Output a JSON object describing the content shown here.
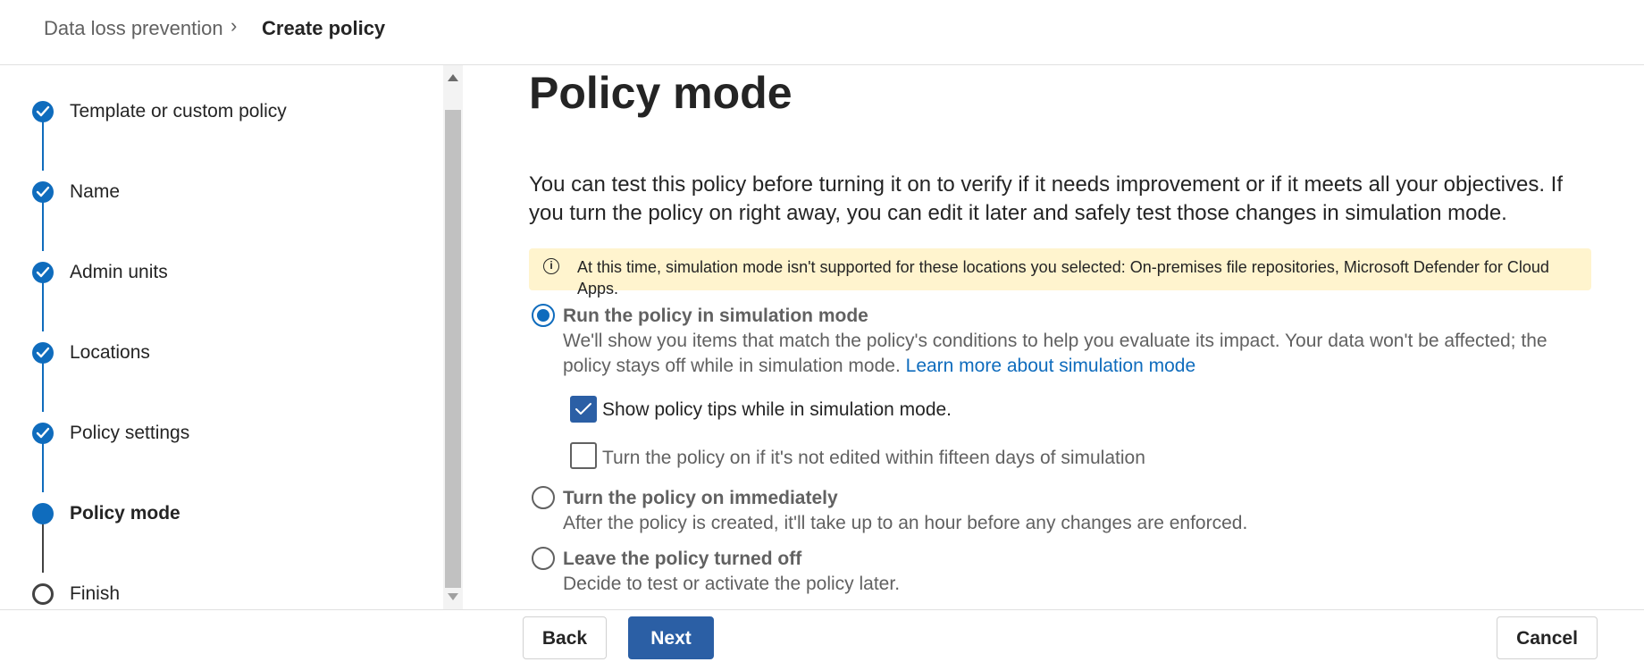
{
  "breadcrumb": {
    "root": "Data loss prevention",
    "separator": "›",
    "current": "Create policy"
  },
  "steps": [
    {
      "label": "Template or custom policy",
      "status": "done"
    },
    {
      "label": "Name",
      "status": "done"
    },
    {
      "label": "Admin units",
      "status": "done"
    },
    {
      "label": "Locations",
      "status": "done"
    },
    {
      "label": "Policy settings",
      "status": "done"
    },
    {
      "label": "Policy mode",
      "status": "current"
    },
    {
      "label": "Finish",
      "status": "todo"
    }
  ],
  "main": {
    "title": "Policy mode",
    "description": "You can test this policy before turning it on to verify if it needs improvement or if it meets all your objectives. If you turn the policy on right away, you can edit it later and safely test those changes in simulation mode.",
    "info_bar": {
      "icon": "info-icon",
      "text": "At this time, simulation mode isn't supported for these locations you selected: On-premises file repositories, Microsoft Defender for Cloud Apps."
    },
    "options": [
      {
        "title": "Run the policy in simulation mode",
        "description": "We'll show you items that match the policy's conditions to help you evaluate its impact. Your data won't be affected; the policy stays off while in simulation mode.",
        "link": "Learn more about simulation mode",
        "selected": true
      },
      {
        "title": "Turn the policy on immediately",
        "description": "After the policy is created, it'll take up to an hour before any changes are enforced.",
        "selected": false
      },
      {
        "title": "Leave the policy turned off",
        "description": "Decide to test or activate the policy later.",
        "selected": false
      }
    ],
    "checkboxes": [
      {
        "label": "Show policy tips while in simulation mode.",
        "checked": true
      },
      {
        "label": "Turn the policy on if it's not edited within fifteen days of simulation",
        "checked": false
      }
    ]
  },
  "footer": {
    "back": "Back",
    "next": "Next",
    "cancel": "Cancel"
  },
  "colors": {
    "accent": "#0f6cbd",
    "primary_button": "#2b5fa5",
    "info_bar": "#fff4ce"
  }
}
